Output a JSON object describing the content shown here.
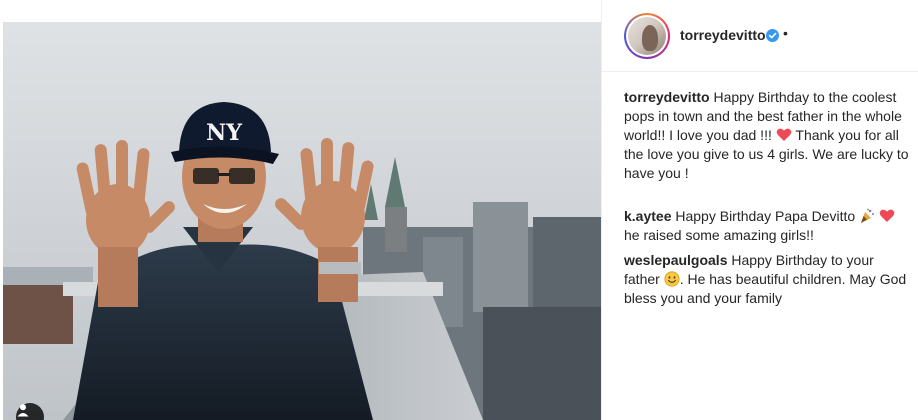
{
  "post": {
    "author": "torreydevitto",
    "verified": true,
    "separator": "•"
  },
  "caption": {
    "username": "torreydevitto",
    "text_before_heart": "Happy Birthday to the coolest pops in town and the best father in the whole world!! I love you dad !!!",
    "heart_icon": "red-heart-icon",
    "text_after_heart": "Thank you for all the love you give to us 4 girls. We are lucky to have you !"
  },
  "comments": [
    {
      "username": "k.aytee",
      "text_before_icons": "Happy Birthday Papa Devitto",
      "icons": [
        "party-popper-icon",
        "red-heart-icon"
      ],
      "text_after_icons": "he raised some amazing girls!!"
    },
    {
      "username": "weslepaulgoals",
      "text_before_icon": "Happy Birthday to your father",
      "icon": "smiling-face-icon",
      "text_after_icon": ". He has beautiful children. May God bless you and your family"
    }
  ],
  "photo": {
    "cap_logo": "NY"
  },
  "colors": {
    "heart": "#ed4956",
    "verified": "#3897f0",
    "text": "#262626",
    "border": "#efefef"
  }
}
